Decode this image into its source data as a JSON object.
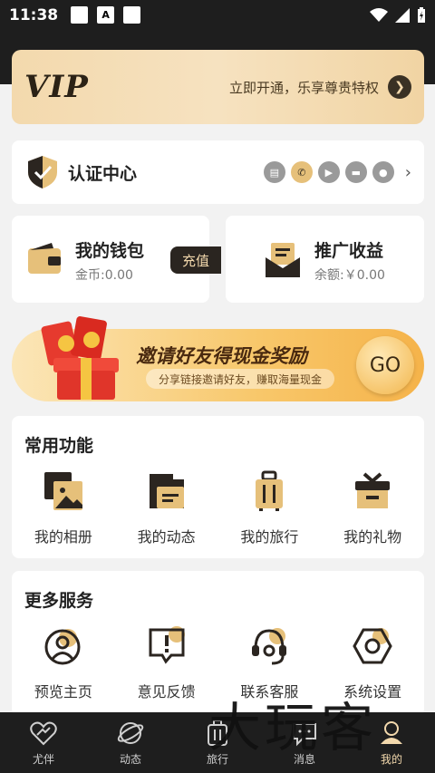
{
  "status_bar": {
    "time": "11:38",
    "a_icon": "A"
  },
  "vip": {
    "logo": "VIP",
    "text": "立即开通，乐享尊贵特权",
    "arrow": "❯"
  },
  "certification": {
    "title": "认证中心",
    "chevron": "›"
  },
  "wallet": {
    "title": "我的钱包",
    "subtitle": "金币:0.00",
    "recharge": "充值"
  },
  "promotion": {
    "title": "推广收益",
    "subtitle": "余额:￥0.00"
  },
  "invite": {
    "title": "邀请好友得现金奖励",
    "subtitle": "分享链接邀请好友，赚取海量现金",
    "go": "GO"
  },
  "common_functions": {
    "title": "常用功能",
    "items": [
      {
        "label": "我的相册",
        "icon": "album-icon"
      },
      {
        "label": "我的动态",
        "icon": "feed-icon"
      },
      {
        "label": "我的旅行",
        "icon": "luggage-icon"
      },
      {
        "label": "我的礼物",
        "icon": "gift-icon"
      }
    ]
  },
  "more_services": {
    "title": "更多服务",
    "items": [
      {
        "label": "预览主页",
        "icon": "profile-icon"
      },
      {
        "label": "意见反馈",
        "icon": "feedback-icon"
      },
      {
        "label": "联系客服",
        "icon": "headset-icon"
      },
      {
        "label": "系统设置",
        "icon": "settings-icon"
      }
    ]
  },
  "tabbar": {
    "items": [
      {
        "label": "尤伴",
        "icon": "heart-icon"
      },
      {
        "label": "动态",
        "icon": "planet-icon"
      },
      {
        "label": "旅行",
        "icon": "suitcase-icon"
      },
      {
        "label": "消息",
        "icon": "chat-icon"
      },
      {
        "label": "我的",
        "icon": "me-icon",
        "active": true
      }
    ]
  },
  "watermark": "大玩客",
  "colors": {
    "gold": "#e6c07a",
    "dark": "#1e1e1e",
    "vip_bg": "#f3d9ad"
  }
}
